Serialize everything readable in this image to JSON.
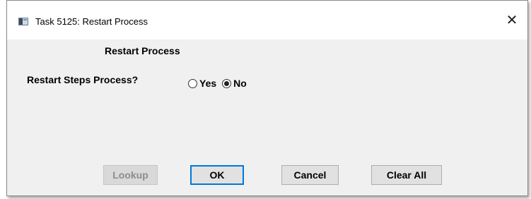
{
  "window": {
    "title": "Task 5125: Restart Process",
    "close_glyph": "✕"
  },
  "form": {
    "heading": "Restart Process",
    "question": "Restart Steps Process?",
    "options": [
      {
        "label": "Yes",
        "selected": false
      },
      {
        "label": "No",
        "selected": true
      }
    ]
  },
  "buttons": {
    "lookup": "Lookup",
    "ok": "OK",
    "cancel": "Cancel",
    "clear_all": "Clear All"
  },
  "colors": {
    "accent": "#0078d7",
    "dialog_background": "#f0f0f0"
  }
}
